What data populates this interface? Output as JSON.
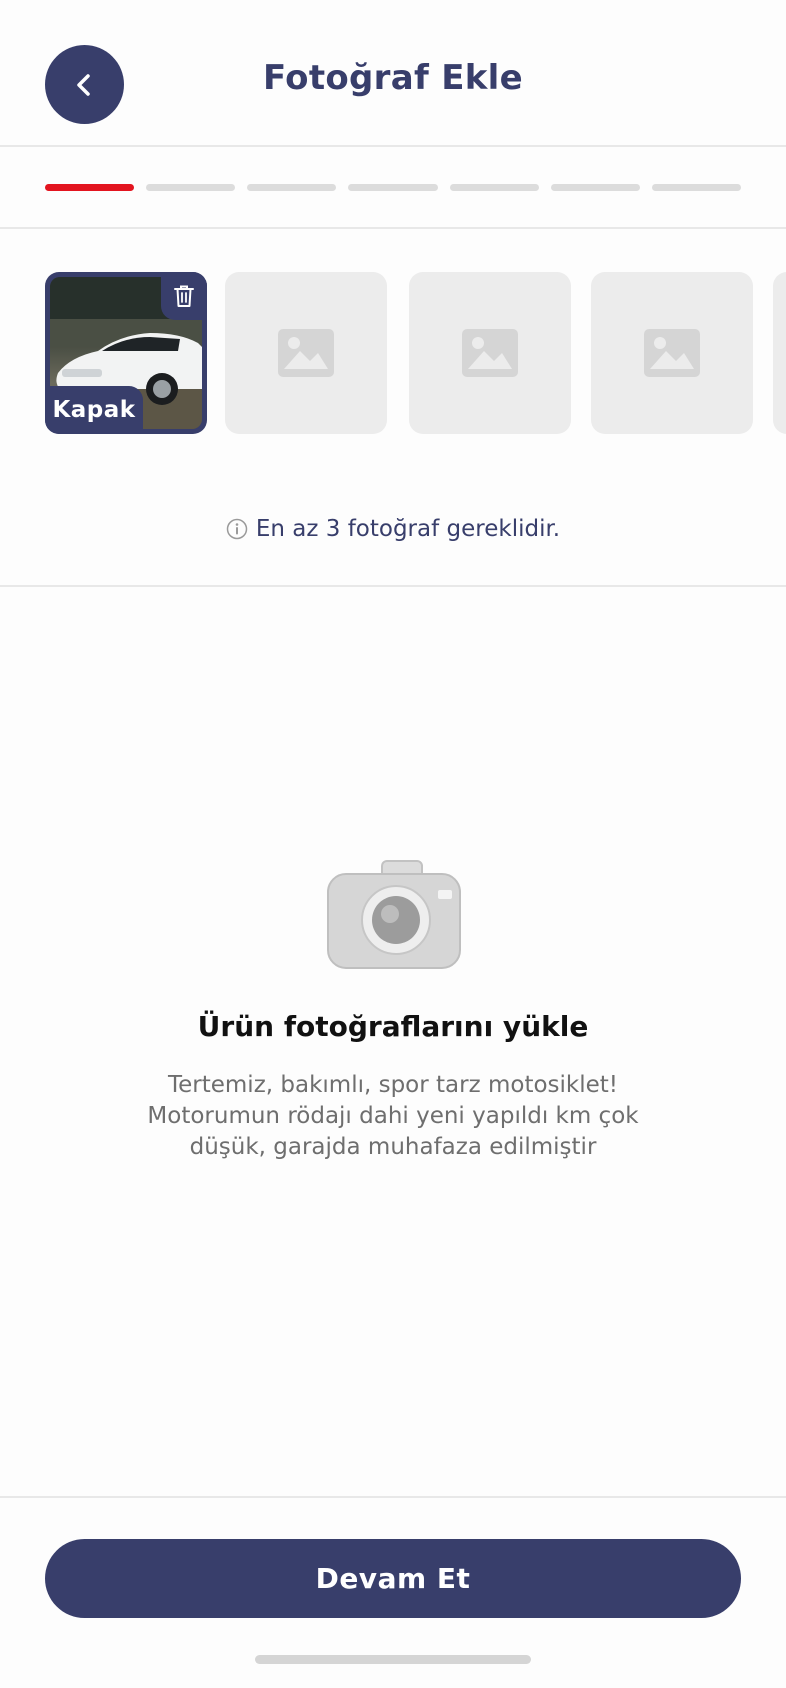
{
  "header": {
    "title": "Fotoğraf Ekle",
    "back_icon": "chevron-left-icon"
  },
  "progress": {
    "total_steps": 7,
    "current_step": 1,
    "active_color": "#e3141f",
    "inactive_color": "#dcdcdc"
  },
  "photos": {
    "slots": [
      {
        "state": "filled",
        "badge": "Kapak"
      },
      {
        "state": "empty"
      },
      {
        "state": "empty"
      },
      {
        "state": "empty"
      },
      {
        "state": "empty"
      }
    ],
    "delete_icon": "trash-icon",
    "placeholder_icon": "image-icon"
  },
  "requirement_note": {
    "icon": "info-icon",
    "text": "En az 3 fotoğraf gereklidir."
  },
  "empty_state": {
    "icon": "camera-icon",
    "title": "Ürün fotoğraflarını yükle",
    "description": "Tertemiz, bakımlı, spor tarz motosiklet! Motorumun rödajı dahi yeni yapıldı km çok düşük, garajda muhafaza edilmiştir"
  },
  "footer": {
    "button_label": "Devam Et"
  },
  "colors": {
    "primary": "#383e6b",
    "accent": "#e3141f"
  }
}
